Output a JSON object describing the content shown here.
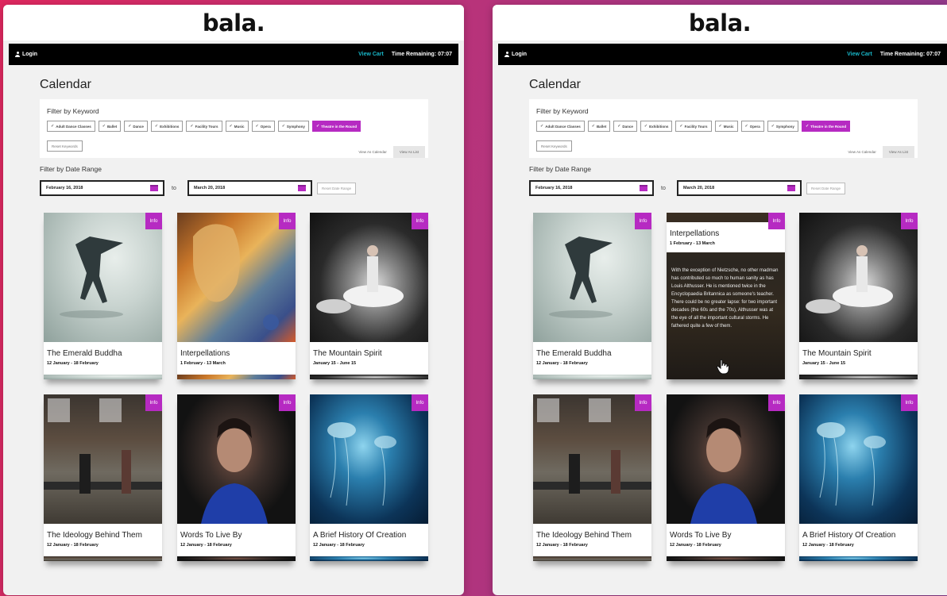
{
  "brand": {
    "logo": "bala."
  },
  "nav": {
    "login": "Login",
    "view_cart": "View Cart",
    "time_remaining": "Time Remaining: 07:07"
  },
  "page": {
    "title": "Calendar"
  },
  "filters": {
    "keyword_label": "Filter by Keyword",
    "keywords": [
      {
        "label": "Adult Dance Classes",
        "active": false
      },
      {
        "label": "Ballet",
        "active": false
      },
      {
        "label": "Dance",
        "active": false
      },
      {
        "label": "Exhibitions",
        "active": false
      },
      {
        "label": "Facility Tours",
        "active": false
      },
      {
        "label": "Music",
        "active": false
      },
      {
        "label": "Opera",
        "active": false
      },
      {
        "label": "Symphony",
        "active": false
      },
      {
        "label": "Theatre in the Round",
        "active": true
      }
    ],
    "reset_keywords": "Reset Keywords",
    "view_as_calendar": "View As Calendar",
    "view_as_list": "View As List",
    "date_label": "Filter by Date Range",
    "date_from": "February 16, 2018",
    "date_to": "March 20, 2018",
    "to_label": "to",
    "reset_dates": "Reset Date Range"
  },
  "cards": [
    {
      "title": "The Emerald Buddha",
      "dates": "12 January - 18 February",
      "info": "Info"
    },
    {
      "title": "Interpellations",
      "dates": "1 February - 13 March",
      "info": "Info"
    },
    {
      "title": "The Mountain Spirit",
      "dates": "January 15 - June 15",
      "info": "Info"
    },
    {
      "title": "The Ideology Behind Them",
      "dates": "12 January - 18 February",
      "info": "Info"
    },
    {
      "title": "Words To Live By",
      "dates": "12 January - 18 February",
      "info": "Info"
    },
    {
      "title": "A Brief History Of Creation",
      "dates": "12 January - 18 February",
      "info": "Info"
    }
  ],
  "hover_card": {
    "title": "Interpellations",
    "dates": "1 February - 13 March",
    "description": "With the exception of Nietzsche, no other madman has contributed so much to human sanity as has Louis Althusser. He is mentioned twice in the Encyclopaedia Britannica as someone's teacher. There could be no greater lapse: for two important decades (the 60s and the 70s), Althusser was at the eye of all the important cultural storms. He fathered quite a few of them."
  }
}
